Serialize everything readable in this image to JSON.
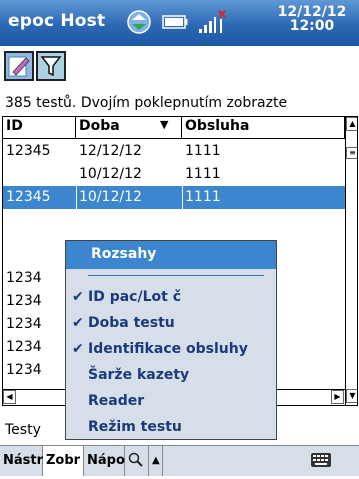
{
  "titlebar": {
    "title": "epoc Host",
    "date": "12/12/12",
    "time": "12:00",
    "icons": [
      "sync-icon",
      "battery-icon",
      "signal-icon"
    ]
  },
  "toolbar": {
    "buttons": [
      {
        "name": "edit-icon"
      },
      {
        "name": "filter-icon"
      }
    ]
  },
  "info_line": "385 testů. Dvojím poklepnutím zobrazte",
  "grid": {
    "columns": [
      "ID",
      "Doba",
      "Obsluha"
    ],
    "rows": [
      {
        "id": "12345",
        "doba": "12/12/12",
        "obsluha": "1111",
        "selected": false
      },
      {
        "id": "",
        "doba": "10/12/12",
        "obsluha": "1111",
        "selected": false
      },
      {
        "id": "12345",
        "doba": "10/12/12",
        "obsluha": "1111",
        "selected": true
      },
      {
        "id": "",
        "doba": "",
        "obsluha": "",
        "selected": false
      },
      {
        "id": "1234",
        "doba": "",
        "obsluha": "",
        "selected": false
      },
      {
        "id": "1234",
        "doba": "",
        "obsluha": "",
        "selected": false
      },
      {
        "id": "1234",
        "doba": "",
        "obsluha": "",
        "selected": false
      },
      {
        "id": "1234",
        "doba": "",
        "obsluha": "",
        "selected": false
      },
      {
        "id": "1234",
        "doba": "",
        "obsluha": "",
        "selected": false
      }
    ]
  },
  "status_line": "Testy",
  "popup": {
    "header": "Rozsahy",
    "items": [
      {
        "label": "ID pac/Lot č",
        "checked": true
      },
      {
        "label": "Doba testu",
        "checked": true
      },
      {
        "label": "Identifikace obsluhy",
        "checked": true
      },
      {
        "label": "Šarže kazety",
        "checked": false
      },
      {
        "label": "Reader",
        "checked": false
      },
      {
        "label": "Režim testu",
        "checked": false
      }
    ]
  },
  "menubar": {
    "items": [
      "Nástr",
      "Zobr",
      "Nápo"
    ],
    "icons": [
      "search-icon",
      "arrow-up-icon",
      "keyboard-icon"
    ]
  },
  "colors": {
    "titlebar": "#2c68b4",
    "selection": "#3b86cf",
    "menubar": "#d6dfe9",
    "menu_text": "#1b3a7b"
  }
}
